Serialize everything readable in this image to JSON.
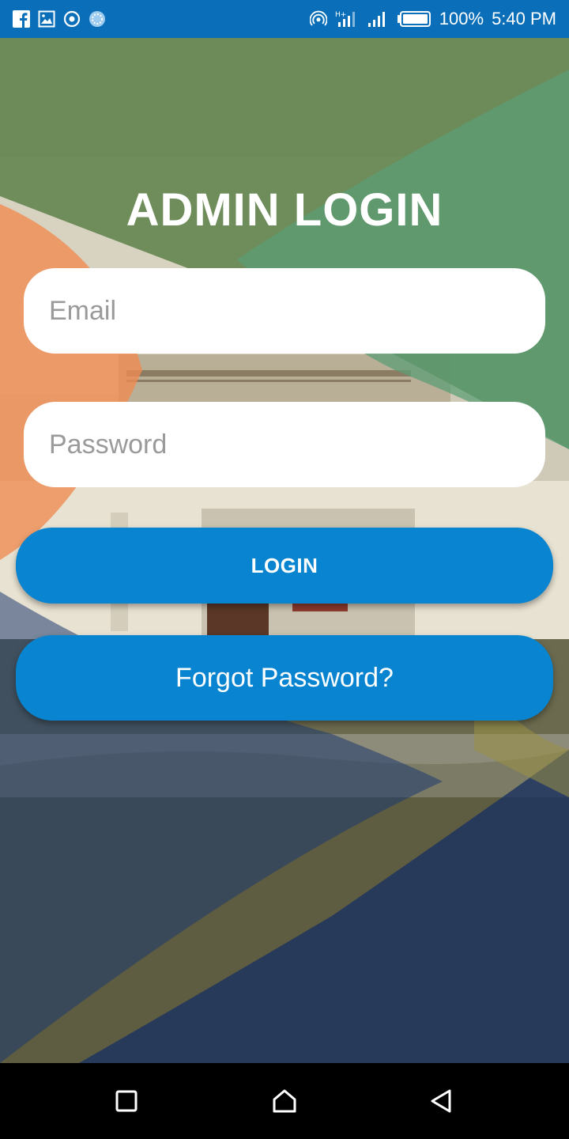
{
  "status_bar": {
    "icons_left": [
      "facebook-icon",
      "gallery-icon",
      "target-icon",
      "loading-icon"
    ],
    "icons_right": [
      "hotspot-icon",
      "signal-h-icon",
      "signal-icon",
      "battery-icon"
    ],
    "battery": "100%",
    "time": "5:40 PM",
    "color": "#0a6fb8"
  },
  "login": {
    "title": "ADMIN LOGIN",
    "email_placeholder": "Email",
    "password_placeholder": "Password",
    "login_label": "LOGIN",
    "forgot_label": "Forgot Password?",
    "button_color": "#0884d0"
  },
  "nav_bar": {
    "icons": [
      "recent-apps-icon",
      "home-icon",
      "back-icon"
    ]
  }
}
